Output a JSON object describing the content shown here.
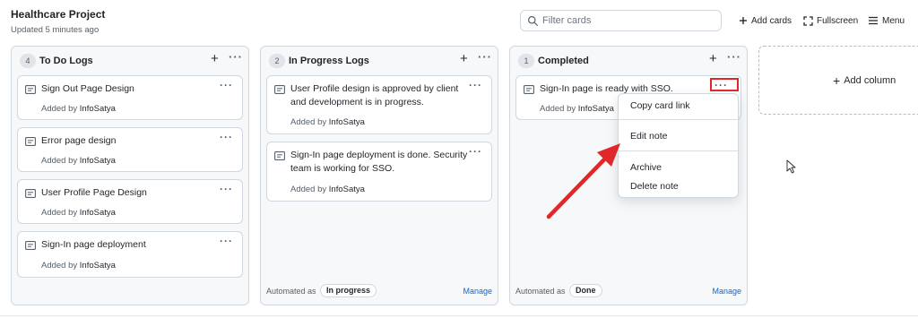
{
  "project": {
    "title": "Healthcare Project",
    "updated": "Updated 5 minutes ago"
  },
  "header": {
    "filter_placeholder": "Filter cards",
    "add_cards_label": "Add cards",
    "fullscreen_label": "Fullscreen",
    "menu_label": "Menu"
  },
  "columns": [
    {
      "count": "4",
      "name": "To Do Logs",
      "cards": [
        {
          "text": "Sign Out Page Design",
          "added_prefix": "Added by ",
          "author": "InfoSatya"
        },
        {
          "text": "Error page design",
          "added_prefix": "Added by ",
          "author": "InfoSatya"
        },
        {
          "text": "User Profile Page Design",
          "added_prefix": "Added by ",
          "author": "InfoSatya"
        },
        {
          "text": "Sign-In page deployment",
          "added_prefix": "Added by ",
          "author": "InfoSatya"
        }
      ]
    },
    {
      "count": "2",
      "name": "In Progress Logs",
      "cards": [
        {
          "text": "User Profile design is approved by client and development is in progress.",
          "added_prefix": "Added by ",
          "author": "InfoSatya"
        },
        {
          "text": "Sign-In page deployment is done. Security team is working for SSO.",
          "added_prefix": "Added by ",
          "author": "InfoSatya"
        }
      ],
      "automated_label": "Automated as",
      "automated_value": "In progress",
      "manage_label": "Manage"
    },
    {
      "count": "1",
      "name": "Completed",
      "cards": [
        {
          "text": "Sign-In page is ready with SSO.",
          "added_prefix": "Added by ",
          "author": "InfoSatya"
        }
      ],
      "automated_label": "Automated as",
      "automated_value": "Done",
      "manage_label": "Manage"
    }
  ],
  "add_column_label": "Add column",
  "context_menu": {
    "items": [
      "Copy card link",
      "Edit note",
      "Archive",
      "Delete note"
    ]
  },
  "colors": {
    "accent_link": "#0969da",
    "annotation_red": "#e0282a",
    "column_bg": "#f6f8fa",
    "border": "#d0d7de"
  },
  "icons": [
    "search-icon",
    "plus-icon",
    "fullscreen-icon",
    "menu-icon",
    "note-icon",
    "more-dots-icon",
    "arrow-annotation",
    "mouse-cursor-icon"
  ]
}
